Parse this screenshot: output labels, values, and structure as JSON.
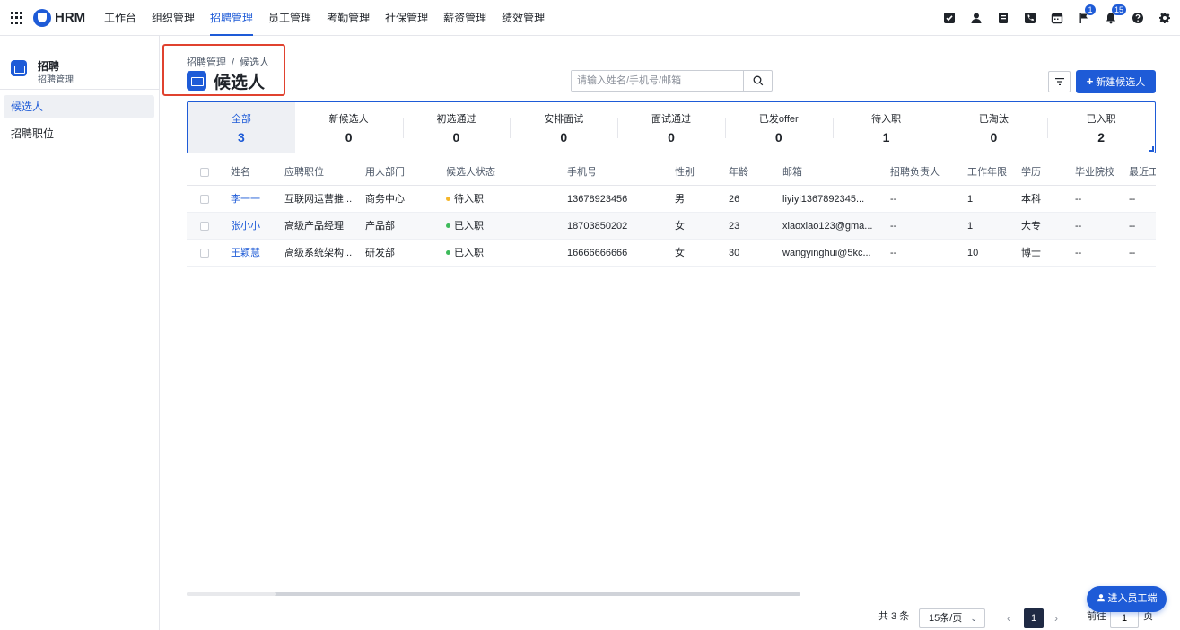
{
  "app": {
    "name": "HRM"
  },
  "nav": [
    {
      "label": "工作台"
    },
    {
      "label": "组织管理"
    },
    {
      "label": "招聘管理"
    },
    {
      "label": "员工管理"
    },
    {
      "label": "考勤管理"
    },
    {
      "label": "社保管理"
    },
    {
      "label": "薪资管理"
    },
    {
      "label": "绩效管理"
    }
  ],
  "toolbar": {
    "flag_badge": "1",
    "bell_badge": "15",
    "icons": [
      "checkbox-icon",
      "user-icon",
      "document-icon",
      "phone-icon",
      "calendar-icon",
      "flag-icon",
      "bell-icon",
      "help-icon",
      "gear-icon"
    ]
  },
  "sidebar": {
    "title": "招聘",
    "subtitle": "招聘管理",
    "items": [
      {
        "label": "候选人"
      },
      {
        "label": "招聘职位"
      }
    ]
  },
  "breadcrumb": {
    "parent": "招聘管理",
    "separator": "/",
    "current": "候选人"
  },
  "page": {
    "title": "候选人"
  },
  "search": {
    "placeholder": "请输入姓名/手机号/邮箱",
    "value": ""
  },
  "actions": {
    "new_label": "新建候选人"
  },
  "stats": [
    {
      "label": "全部",
      "count": "3"
    },
    {
      "label": "新候选人",
      "count": "0"
    },
    {
      "label": "初选通过",
      "count": "0"
    },
    {
      "label": "安排面试",
      "count": "0"
    },
    {
      "label": "面试通过",
      "count": "0"
    },
    {
      "label": "已发offer",
      "count": "0"
    },
    {
      "label": "待入职",
      "count": "1"
    },
    {
      "label": "已淘汰",
      "count": "0"
    },
    {
      "label": "已入职",
      "count": "2"
    }
  ],
  "table": {
    "columns": [
      "姓名",
      "应聘职位",
      "用人部门",
      "候选人状态",
      "手机号",
      "性别",
      "年龄",
      "邮箱",
      "招聘负责人",
      "工作年限",
      "学历",
      "毕业院校",
      "最近工"
    ],
    "rows": [
      {
        "name": "李一一",
        "position": "互联网运营推...",
        "dept": "商务中心",
        "status": "待入职",
        "status_color": "#f5b62a",
        "phone": "13678923456",
        "gender": "男",
        "age": "26",
        "email": "liyiyi1367892345...",
        "recruiter": "--",
        "years": "1",
        "education": "本科",
        "school": "--",
        "recent": "--"
      },
      {
        "name": "张小小",
        "position": "高级产品经理",
        "dept": "产品部",
        "status": "已入职",
        "status_color": "#3dba5a",
        "phone": "18703850202",
        "gender": "女",
        "age": "23",
        "email": "xiaoxiao123@gma...",
        "recruiter": "--",
        "years": "1",
        "education": "大专",
        "school": "--",
        "recent": "--"
      },
      {
        "name": "王颖慧",
        "position": "高级系统架构...",
        "dept": "研发部",
        "status": "已入职",
        "status_color": "#3dba5a",
        "phone": "16666666666",
        "gender": "女",
        "age": "30",
        "email": "wangyinghui@5kc...",
        "recruiter": "--",
        "years": "10",
        "education": "博士",
        "school": "--",
        "recent": "--"
      }
    ]
  },
  "pagination": {
    "total_text": "共 3 条",
    "page_size": "15条/页",
    "current_page": "1",
    "goto_label": "前往",
    "goto_value": "1",
    "page_unit": "页"
  },
  "employee_portal": {
    "label": "进入员工端"
  }
}
